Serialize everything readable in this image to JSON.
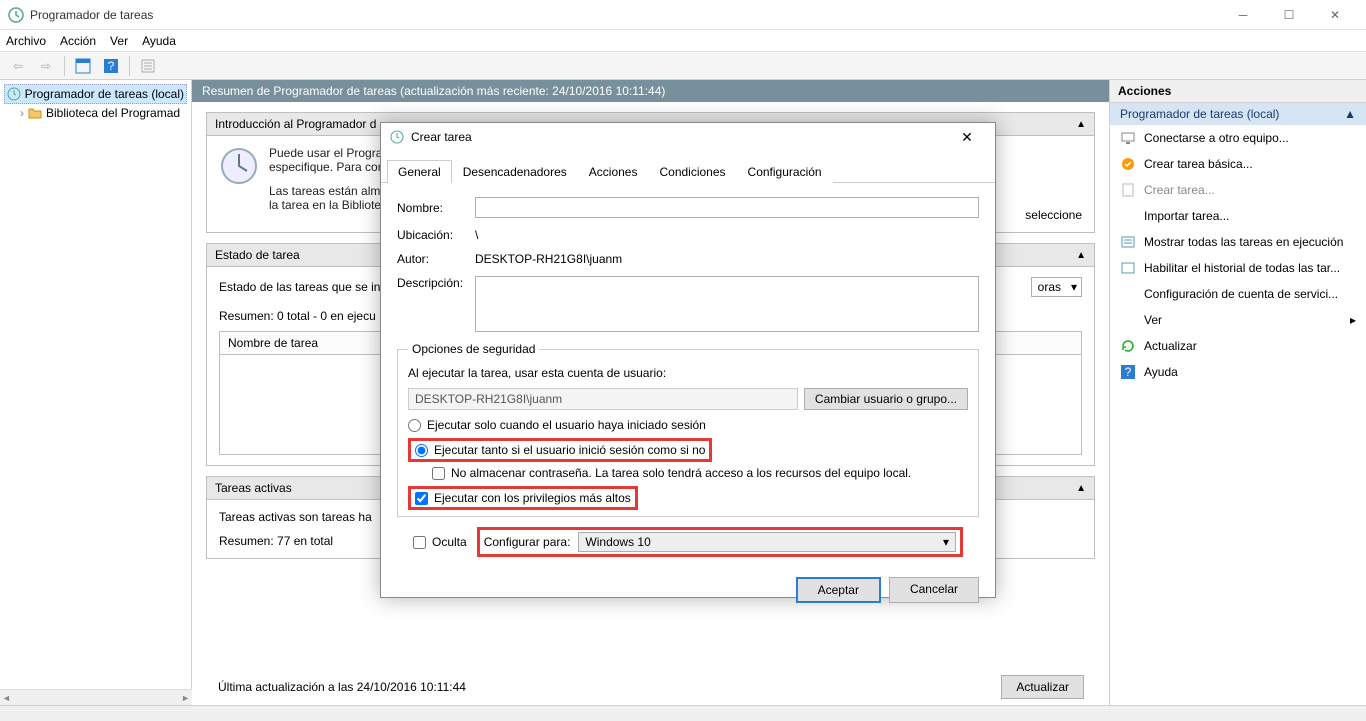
{
  "window": {
    "title": "Programador de tareas"
  },
  "menu": {
    "file": "Archivo",
    "action": "Acción",
    "view": "Ver",
    "help": "Ayuda"
  },
  "tree": {
    "root": "Programador de tareas (local)",
    "child": "Biblioteca del Programad"
  },
  "center": {
    "header": "Resumen de Programador de tareas (actualización más reciente: 24/10/2016 10:11:44)",
    "intro_title": "Introducción al Programador d",
    "intro_p1": "Puede usar el Programa",
    "intro_p1b": "especifique. Para com",
    "intro_p2": "Las tareas están almac",
    "intro_p2b": "la tarea en la Biblioteca",
    "intro_p2c": "seleccione",
    "status_title": "Estado de tarea",
    "status_line": "Estado de las tareas que se ini",
    "status_hours": "oras",
    "status_summary": "Resumen: 0 total - 0 en ejecu",
    "column": "Nombre de tarea",
    "active_title": "Tareas activas",
    "active_line": "Tareas activas son tareas ha",
    "active_summary": "Resumen: 77 en total",
    "footer": "Última actualización a las 24/10/2016 10:11:44",
    "refresh_btn": "Actualizar"
  },
  "actions_panel": {
    "title": "Acciones",
    "group": "Programador de tareas (local)",
    "items": {
      "connect": "Conectarse a otro equipo...",
      "basic": "Crear tarea básica...",
      "create": "Crear tarea...",
      "import": "Importar tarea...",
      "showall": "Mostrar todas las tareas en ejecución",
      "history": "Habilitar el historial de todas las tar...",
      "account": "Configuración de cuenta de servici...",
      "view": "Ver",
      "refresh": "Actualizar",
      "help": "Ayuda"
    }
  },
  "dialog": {
    "title": "Crear tarea",
    "tabs": {
      "general": "General",
      "triggers": "Desencadenadores",
      "actions": "Acciones",
      "conditions": "Condiciones",
      "config": "Configuración"
    },
    "labels": {
      "name": "Nombre:",
      "location": "Ubicación:",
      "author": "Autor:",
      "description": "Descripción:"
    },
    "values": {
      "name": "",
      "location": "\\",
      "author": "DESKTOP-RH21G8I\\juanm"
    },
    "security": {
      "legend": "Opciones de seguridad",
      "runas_label": "Al ejecutar la tarea, usar esta cuenta de usuario:",
      "runas_user": "DESKTOP-RH21G8I\\juanm",
      "change_btn": "Cambiar usuario o grupo...",
      "radio1": "Ejecutar solo cuando el usuario haya iniciado sesión",
      "radio2": "Ejecutar tanto si el usuario inició sesión como si no",
      "nostore": "No almacenar contraseña. La tarea solo tendrá acceso a los recursos del equipo local.",
      "highest": "Ejecutar con los privilegios más altos"
    },
    "bottom": {
      "hidden": "Oculta",
      "configure_for": "Configurar para:",
      "os": "Windows 10"
    },
    "ok": "Aceptar",
    "cancel": "Cancelar"
  }
}
